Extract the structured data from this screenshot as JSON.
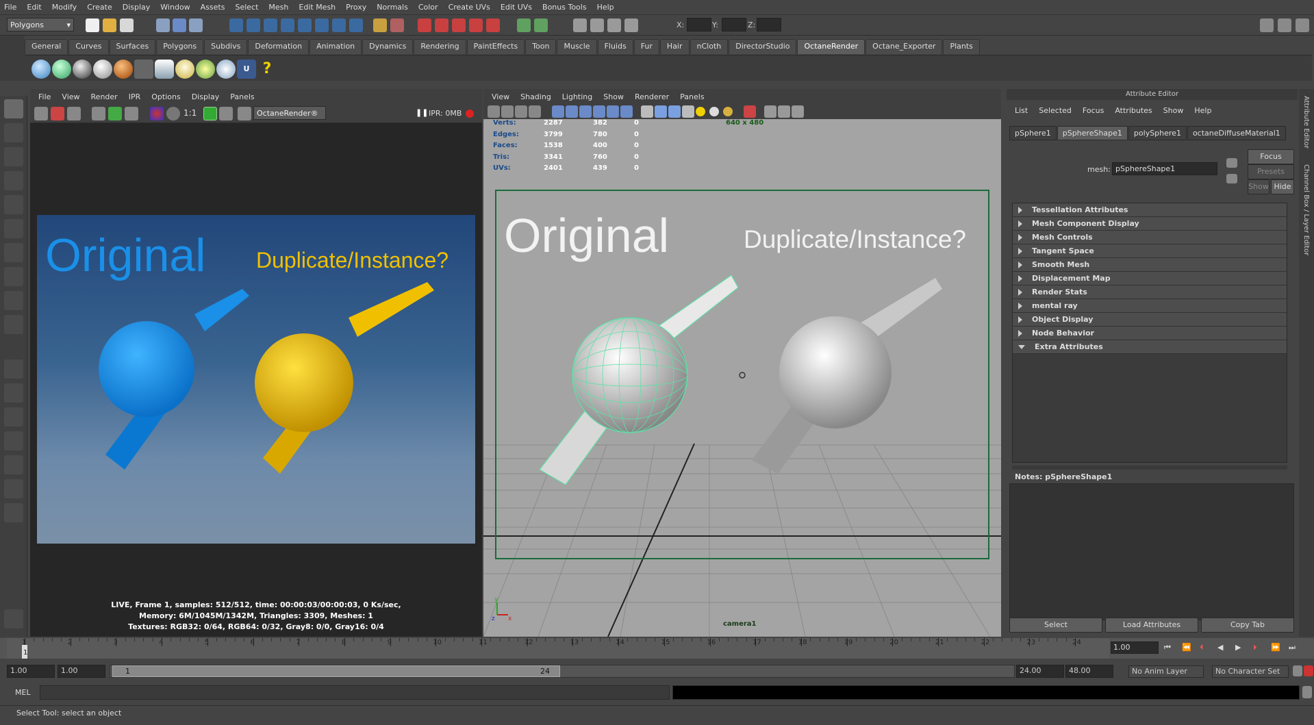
{
  "menubar": {
    "items": [
      "File",
      "Edit",
      "Modify",
      "Create",
      "Display",
      "Window",
      "Assets",
      "Select",
      "Mesh",
      "Edit Mesh",
      "Proxy",
      "Normals",
      "Color",
      "Create UVs",
      "Edit UVs",
      "Bonus Tools",
      "Help"
    ]
  },
  "status": {
    "mode": "Polygons",
    "x_label": "X:",
    "y_label": "Y:",
    "z_label": "Z:"
  },
  "shelf": {
    "tabs": [
      "General",
      "Curves",
      "Surfaces",
      "Polygons",
      "Subdivs",
      "Deformation",
      "Animation",
      "Dynamics",
      "Rendering",
      "PaintEffects",
      "Toon",
      "Muscle",
      "Fluids",
      "Fur",
      "Hair",
      "nCloth",
      "DirectorStudio",
      "OctaneRender",
      "Octane_Exporter",
      "Plants"
    ],
    "active": "OctaneRender"
  },
  "renderview": {
    "menu": [
      "File",
      "View",
      "Render",
      "IPR",
      "Options",
      "Display",
      "Panels"
    ],
    "ratio": "1:1",
    "renderer": "OctaneRender®",
    "ipr": "IPR: 0MB",
    "image": {
      "original": "Original",
      "duplicate": "Duplicate/Instance?"
    },
    "stats": [
      "LIVE, Frame 1, samples: 512/512, time: 00:00:03/00:00:03, 0 Ks/sec,",
      "Memory: 6M/1045M/1342M, Triangles: 3309, Meshes: 1",
      "Textures: RGB32: 0/64, RGB64: 0/32, Gray8: 0/0, Gray16: 0/4"
    ]
  },
  "viewport": {
    "menu": [
      "View",
      "Shading",
      "Lighting",
      "Show",
      "Renderer",
      "Panels"
    ],
    "resolution": "640 x 480",
    "camera": "camera1",
    "hud": [
      {
        "label": "Verts:",
        "a": "2287",
        "b": "382",
        "c": "0"
      },
      {
        "label": "Edges:",
        "a": "3799",
        "b": "780",
        "c": "0"
      },
      {
        "label": "Faces:",
        "a": "1538",
        "b": "400",
        "c": "0"
      },
      {
        "label": "Tris:",
        "a": "3341",
        "b": "760",
        "c": "0"
      },
      {
        "label": "UVs:",
        "a": "2401",
        "b": "439",
        "c": "0"
      }
    ],
    "original": "Original",
    "duplicate": "Duplicate/Instance?",
    "axis_y": "y",
    "axis_x": "x",
    "axis_z": "z"
  },
  "attribute_editor": {
    "title": "Attribute Editor",
    "menu": [
      "List",
      "Selected",
      "Focus",
      "Attributes",
      "Show",
      "Help"
    ],
    "tabs": [
      "pSphere1",
      "pSphereShape1",
      "polySphere1",
      "octaneDiffuseMaterial1"
    ],
    "active_tab": "pSphereShape1",
    "mesh_label": "mesh:",
    "mesh_value": "pSphereShape1",
    "focus": "Focus",
    "presets": "Presets",
    "show": "Show",
    "hide": "Hide",
    "sections": [
      "Tessellation Attributes",
      "Mesh Component Display",
      "Mesh Controls",
      "Tangent Space",
      "Smooth Mesh",
      "Displacement Map",
      "Render Stats",
      "mental ray",
      "Object Display",
      "Node Behavior",
      "Extra Attributes"
    ],
    "notes_label": "Notes:  pSphereShape1",
    "buttons": [
      "Select",
      "Load Attributes",
      "Copy Tab"
    ],
    "side_tabs": [
      "Attribute Editor",
      "Channel Box / Layer Editor"
    ]
  },
  "timeline": {
    "ticks": [
      "1",
      "2",
      "3",
      "4",
      "5",
      "6",
      "7",
      "8",
      "9",
      "10",
      "11",
      "12",
      "13",
      "14",
      "15",
      "16",
      "17",
      "18",
      "19",
      "20",
      "21",
      "22",
      "23",
      "24"
    ],
    "current": "1",
    "current_frame": "1.00"
  },
  "range": {
    "start": "1.00",
    "start2": "1.00",
    "slider_start": "1",
    "slider_end": "24",
    "end": "24.00",
    "end2": "48.00",
    "anim_layer": "No Anim Layer",
    "char_set": "No Character Set"
  },
  "cmd": {
    "label": "MEL"
  },
  "help": {
    "text": "Select Tool: select an object"
  },
  "colors": {
    "blue": "#1a90e8",
    "yellow": "#f0c000",
    "wire": "#5fe0a8",
    "accent": "#5d5d5d"
  }
}
